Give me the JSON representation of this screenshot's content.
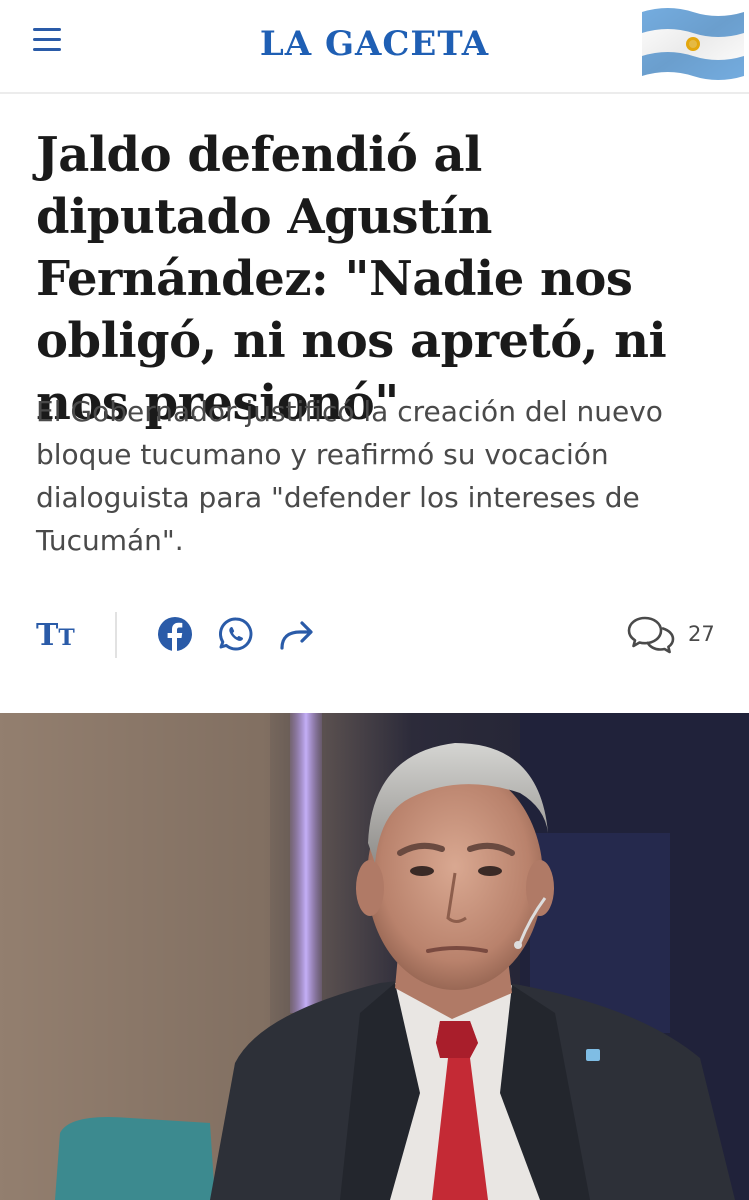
{
  "header": {
    "logo": "LA GACETA",
    "menu_icon": "hamburger-menu-icon",
    "flag_icon": "argentina-flag-icon",
    "accent_color": "#1f5fb4"
  },
  "article": {
    "headline": "Jaldo defendió al diputado Agustín Fernández: \"Nadie nos obligó, ni nos apretó, ni nos presionó\"",
    "subtitle": "El Gobernador justificó la creación del nuevo bloque tucumano y reafirmó su vocación dialoguista para \"defender los intereses de Tucumán\"."
  },
  "toolbar": {
    "text_size_big": "T",
    "text_size_small": "T",
    "icons": [
      "text-size-icon",
      "facebook-icon",
      "whatsapp-icon",
      "share-icon",
      "comments-icon"
    ],
    "comment_count": "27"
  }
}
